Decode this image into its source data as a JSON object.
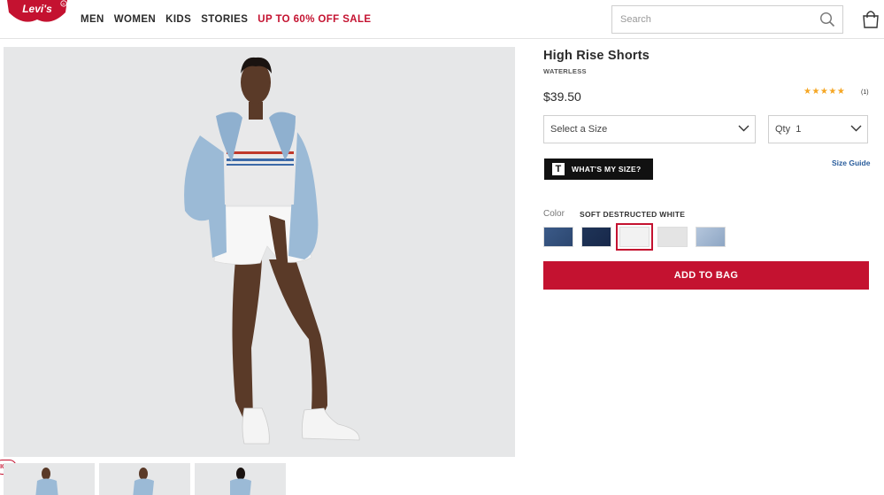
{
  "header": {
    "logo_text": "Levi's",
    "nav": [
      {
        "label": "MEN"
      },
      {
        "label": "WOMEN"
      },
      {
        "label": "KIDS"
      },
      {
        "label": "STORIES"
      },
      {
        "label": "UP TO 60% OFF SALE",
        "color": "#c41230"
      }
    ],
    "search_placeholder": "Search",
    "search_icon": "search-icon",
    "bag_icon": "shopping-bag-icon"
  },
  "gallery": {
    "zoom_controls": [
      "+",
      "—",
      "×"
    ],
    "badge_text": "IGO",
    "thumbnails_count": 3
  },
  "product": {
    "title": "High Rise Shorts",
    "subtitle": "WATERLESS",
    "price": "$39.50",
    "rating_stars": "★★★★★",
    "rating_value": 5,
    "rating_count": "(1)",
    "size_select": "Select a Size",
    "qty_label": "Qty",
    "qty_value": "1",
    "size_button": "WHAT'S MY SIZE?",
    "size_button_logo": "T",
    "size_guide": "Size Guide",
    "color_label": "Color",
    "color_value": "SOFT DESTRUCTED WHITE",
    "swatches": [
      {
        "name": "medium-wash",
        "color": "#3b5a88"
      },
      {
        "name": "dark-wash",
        "color": "#1f3458"
      },
      {
        "name": "soft-destructed-white",
        "color": "#f2f2f2",
        "selected": true
      },
      {
        "name": "light-grey",
        "color": "#e4e4e4"
      },
      {
        "name": "light-blue-floral",
        "color": "#a8bcd4"
      }
    ],
    "add_to_bag": "ADD TO BAG"
  },
  "colors": {
    "brand_red": "#c41230",
    "link_blue": "#2a5d9c",
    "star": "#f5a623"
  }
}
